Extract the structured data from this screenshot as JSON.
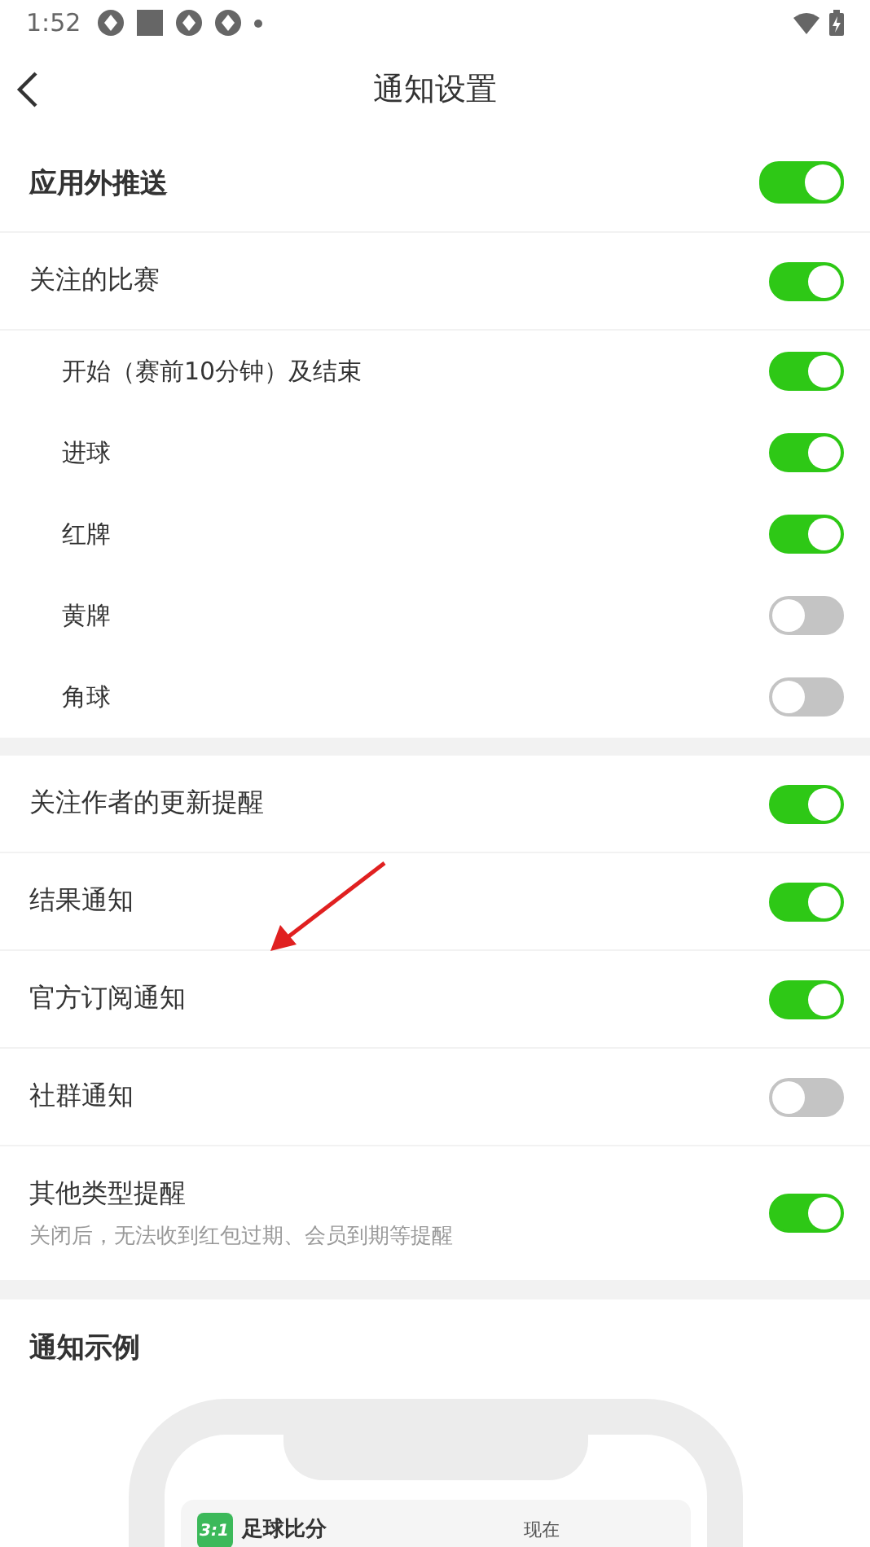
{
  "status_bar": {
    "time": "1:52"
  },
  "header": {
    "title": "通知设置"
  },
  "sections": [
    {
      "rows": [
        {
          "kind": "main",
          "label": "应用外推送",
          "on": true
        },
        {
          "kind": "normal",
          "label": "关注的比赛",
          "on": true
        },
        {
          "kind": "sub",
          "label": "开始（赛前10分钟）及结束",
          "on": true
        },
        {
          "kind": "sub",
          "label": "进球",
          "on": true
        },
        {
          "kind": "sub",
          "label": "红牌",
          "on": true
        },
        {
          "kind": "sub",
          "label": "黄牌",
          "on": false
        },
        {
          "kind": "sub",
          "label": "角球",
          "on": false
        }
      ]
    },
    {
      "rows": [
        {
          "kind": "normal",
          "label": "关注作者的更新提醒",
          "on": true
        },
        {
          "kind": "normal",
          "label": "结果通知",
          "on": true
        },
        {
          "kind": "normal",
          "label": "官方订阅通知",
          "on": true
        },
        {
          "kind": "normal",
          "label": "社群通知",
          "on": false
        },
        {
          "kind": "normal",
          "label": "其他类型提醒",
          "hint": "关闭后，无法收到红包过期、会员到期等提醒",
          "on": true
        }
      ]
    }
  ],
  "example": {
    "title": "通知示例",
    "app_badge": "3:1",
    "app_name": "足球比分",
    "time": "现在"
  }
}
